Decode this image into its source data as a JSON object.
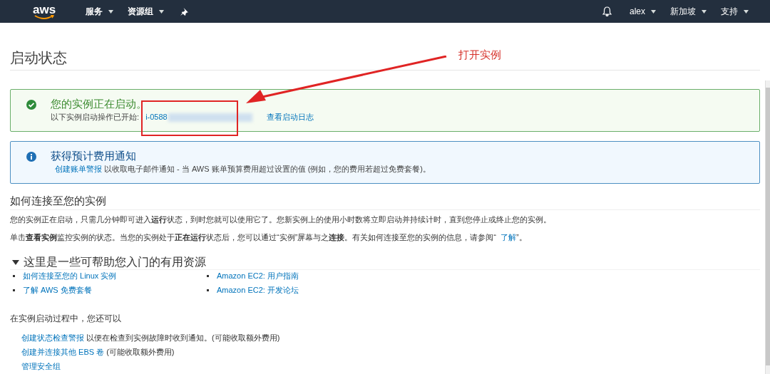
{
  "nav": {
    "logo": "aws",
    "menus": [
      {
        "label": "服务"
      },
      {
        "label": "资源组"
      }
    ],
    "user": "alex",
    "region": "新加坡",
    "support": "支持"
  },
  "page_title": "启动状态",
  "alerts": [
    {
      "kind": "success",
      "title": "您的实例正在启动。",
      "parts": [
        {
          "kind": "text",
          "text": "以下实例启动操作已开始: "
        },
        {
          "kind": "link",
          "text": "i-0588"
        },
        {
          "kind": "redacted"
        },
        {
          "kind": "link",
          "text": "查看启动日志"
        }
      ]
    },
    {
      "kind": "info",
      "title": "获得预计费用通知",
      "parts": [
        {
          "kind": "link",
          "text": "创建账单警报"
        },
        {
          "kind": "text",
          "text": " 以收取电子邮件通知 - 当 AWS 账单预算费用超过设置的值 (例如，您的费用若超过免费套餐)。"
        }
      ]
    }
  ],
  "connect": {
    "heading": "如何连接至您的实例",
    "paragraphs": [
      [
        {
          "kind": "text",
          "text": "您的实例正在启动，只需几分钟即可进入**运行**状态，到时您就可以使用它了。您新实例上的使用小时数将立即启动并持续计时，直到您停止或终止您的实例。"
        }
      ],
      [
        {
          "kind": "text",
          "text": "单击**查看实例**监控实例的状态。当您的实例处于**正在运行**状态后，您可以通过“实例”屏幕与之**连接**。有关如何连接至您的实例的信息，请参阅“"
        },
        {
          "kind": "link",
          "text": "了解"
        },
        {
          "kind": "text",
          "text": "”。"
        }
      ]
    ]
  },
  "resources": {
    "heading": "这里是一些可帮助您入门的有用资源",
    "expanded": true,
    "links": [
      "如何连接至您的 Linux 实例",
      "Amazon EC2: 用户指南",
      "了解 AWS 免费套餐",
      "Amazon EC2: 开发论坛"
    ]
  },
  "while_launching": {
    "heading": "在实例启动过程中，您还可以",
    "items": [
      {
        "link": "创建状态检查警报",
        "note": " 以便在检查到实例故障时收到通知。(可能收取额外费用)"
      },
      {
        "link": "创建并连接其他 EBS 卷",
        "note": " (可能收取额外费用)"
      },
      {
        "link": "管理安全组"
      }
    ]
  },
  "annotation": {
    "label": "打开实例"
  }
}
